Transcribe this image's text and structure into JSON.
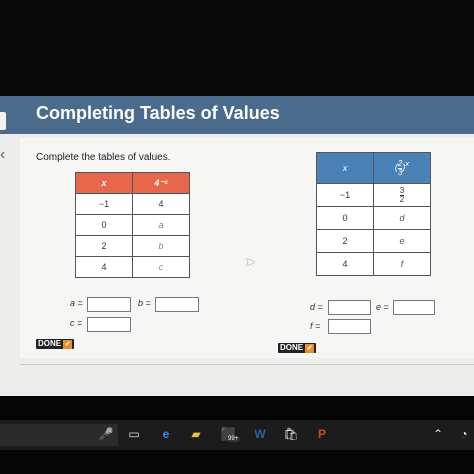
{
  "app": {
    "title": "Completing Tables of Values"
  },
  "instructions": "Complete the tables of values.",
  "table_left": {
    "headers": [
      "x",
      "4⁻ˣ"
    ],
    "rows": [
      [
        "−1",
        "4"
      ],
      [
        "0",
        "a"
      ],
      [
        "2",
        "b"
      ],
      [
        "4",
        "c"
      ]
    ]
  },
  "table_right": {
    "headers": [
      "x",
      "(2/3)ˣ"
    ],
    "header_frac": {
      "num": "2",
      "den": "3",
      "exp": "x"
    },
    "rows": [
      [
        "−1",
        "3/2"
      ],
      [
        "0",
        "d"
      ],
      [
        "2",
        "e"
      ],
      [
        "4",
        "f"
      ]
    ],
    "row0_frac": {
      "num": "3",
      "den": "2"
    }
  },
  "answers": {
    "a_label": "a =",
    "b_label": "b =",
    "c_label": "c =",
    "d_label": "d =",
    "e_label": "e =",
    "f_label": "f =",
    "a_value": "",
    "b_value": "",
    "c_value": "",
    "d_value": "",
    "e_value": "",
    "f_value": ""
  },
  "buttons": {
    "done_left": "DONE",
    "done_right": "DONE",
    "check_glyph": "✔"
  },
  "taskbar": {
    "icons": [
      "microphone-icon",
      "task-view-icon",
      "edge-icon",
      "file-explorer-icon",
      "badge-app-icon",
      "word-icon",
      "store-icon",
      "powerpoint-icon",
      "notifications-icon",
      "volume-icon"
    ],
    "badge_text": "99+"
  },
  "colors": {
    "header": "#4a6b8c",
    "left_table_header": "#e8674c",
    "right_table_header": "#4a82b8",
    "done_check": "#f08a24"
  }
}
